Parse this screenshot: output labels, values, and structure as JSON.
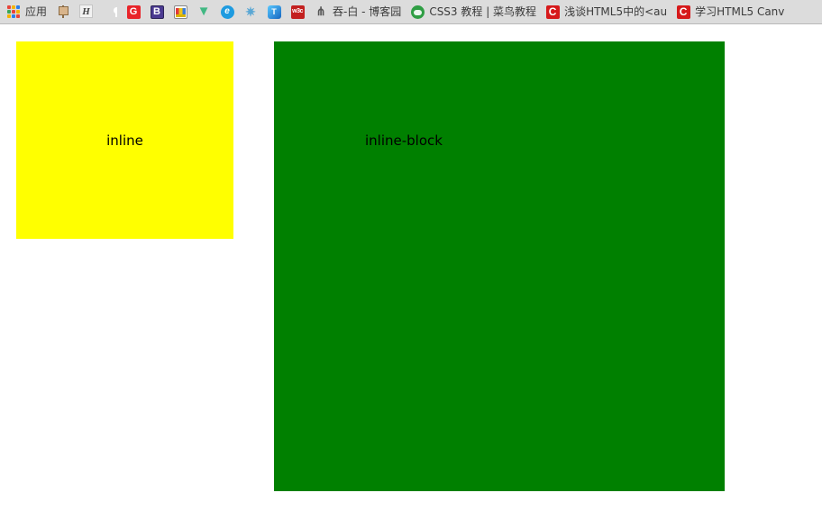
{
  "browser": {
    "apps_button": {
      "label": "应用",
      "icon": "apps-grid-icon"
    },
    "bookmarks": [
      {
        "icon": "cube-icon",
        "label": ""
      },
      {
        "icon": "script-h-icon",
        "label": ""
      },
      {
        "icon": "github-icon",
        "label": ""
      },
      {
        "icon": "g-red-icon",
        "label": ""
      },
      {
        "icon": "bootstrap-b-icon",
        "label": ""
      },
      {
        "icon": "crown-icon",
        "label": ""
      },
      {
        "icon": "vue-v-icon",
        "label": ""
      },
      {
        "icon": "blue-e-icon",
        "label": ""
      },
      {
        "icon": "atom-icon",
        "label": ""
      },
      {
        "icon": "blue-t-icon",
        "label": ""
      },
      {
        "icon": "w3c-icon",
        "label": "w3c"
      },
      {
        "icon": "pen-icon",
        "label": "吞-白 - 博客园"
      },
      {
        "icon": "green-circle-icon",
        "label": "CSS3 教程 | 菜鸟教程"
      },
      {
        "icon": "red-c-icon",
        "label": "浅谈HTML5中的<au"
      },
      {
        "icon": "red-c-icon",
        "label": "学习HTML5 Canv"
      }
    ]
  },
  "page": {
    "boxes": [
      {
        "name": "inline",
        "text": "inline",
        "color": "#ffff00"
      },
      {
        "name": "inline-block",
        "text": "inline-block",
        "color": "#008000"
      }
    ]
  }
}
